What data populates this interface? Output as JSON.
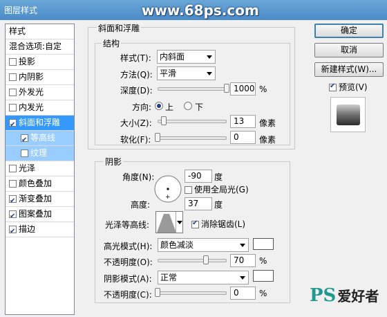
{
  "window": {
    "title": "图层样式",
    "watermark": "www.68ps.com"
  },
  "sidebar": {
    "header": "样式",
    "blend": "混合选项:自定",
    "items": [
      {
        "label": "投影",
        "checked": false
      },
      {
        "label": "内阴影",
        "checked": false
      },
      {
        "label": "外发光",
        "checked": false
      },
      {
        "label": "内发光",
        "checked": false
      },
      {
        "label": "斜面和浮雕",
        "checked": true
      },
      {
        "label": "等高线",
        "checked": true
      },
      {
        "label": "纹理",
        "checked": false
      },
      {
        "label": "光泽",
        "checked": false
      },
      {
        "label": "颜色叠加",
        "checked": false
      },
      {
        "label": "渐变叠加",
        "checked": true
      },
      {
        "label": "图案叠加",
        "checked": true
      },
      {
        "label": "描边",
        "checked": true
      }
    ]
  },
  "bevel": {
    "group_title": "斜面和浮雕",
    "structure_title": "结构",
    "style_label": "样式(T):",
    "style_value": "内斜面",
    "method_label": "方法(Q):",
    "method_value": "平滑",
    "depth_label": "深度(D):",
    "depth_value": "1000",
    "depth_unit": "%",
    "depth_fraction": 1.0,
    "direction_label": "方向:",
    "dir_up": "上",
    "dir_down": "下",
    "size_label": "大小(Z):",
    "size_value": "13",
    "size_unit": "像素",
    "soften_label": "软化(F):",
    "soften_value": "0",
    "soften_unit": "像素"
  },
  "shading": {
    "title": "阴影",
    "angle_label": "角度(N):",
    "angle_value": "-90",
    "angle_unit": "度",
    "global_light_label": "使用全局光(G)",
    "global_light": false,
    "altitude_label": "高度:",
    "altitude_value": "37",
    "altitude_unit": "度",
    "gloss_label": "光泽等高线:",
    "antialias_label": "消除锯齿(L)",
    "antialias": true,
    "highlight_mode_label": "高光模式(H):",
    "highlight_mode": "颜色减淡",
    "highlight_color": "#ffffff",
    "hl_opacity_label": "不透明度(O):",
    "hl_opacity_value": "70",
    "hl_opacity_unit": "%",
    "shadow_mode_label": "阴影模式(A):",
    "shadow_mode": "正常",
    "shadow_color": "#ffffff",
    "sh_opacity_label": "不透明度(C):",
    "sh_opacity_value": "0",
    "sh_opacity_unit": "%"
  },
  "buttons": {
    "ok": "确定",
    "cancel": "取消",
    "new_style": "新建样式(W)...",
    "preview": "预览(V)"
  },
  "logo": {
    "brand": "PS",
    "text": "爱好者"
  }
}
